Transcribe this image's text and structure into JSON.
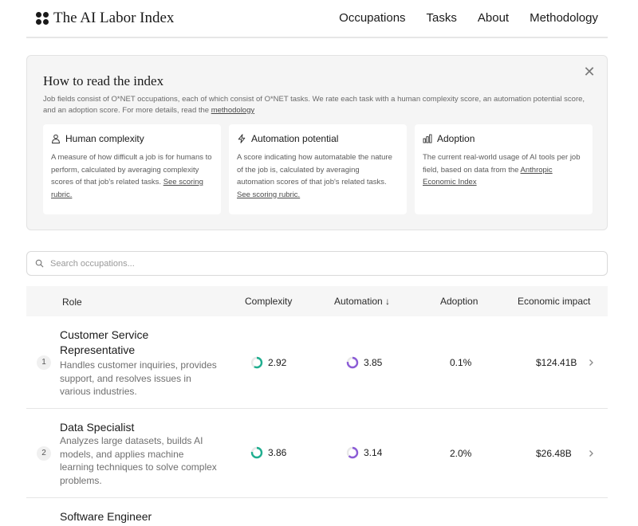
{
  "header": {
    "brand": "The AI Labor Index",
    "nav": [
      "Occupations",
      "Tasks",
      "About",
      "Methodology"
    ]
  },
  "info": {
    "title": "How to read the index",
    "desc_text": "Job fields consist of O*NET occupations, each of which consist of O*NET tasks. We rate each task with a human complexity score, an automation potential score, and an adoption score. For more details, read the ",
    "desc_link": "methodology",
    "cards": [
      {
        "icon": "person-icon",
        "title": "Human complexity",
        "text": "A measure of how difficult a job is for humans to perform, calculated by averaging complexity scores of that job's related tasks. ",
        "link": "See scoring rubric."
      },
      {
        "icon": "lightning-icon",
        "title": "Automation potential",
        "text": "A score indicating how automatable the nature of the job is, calculated by averaging automation scores of that job's related tasks. ",
        "link": "See scoring rubric."
      },
      {
        "icon": "bar-chart-icon",
        "title": "Adoption",
        "text": "The current real-world usage of AI tools per job field, based on data from the ",
        "link": "Anthropic Economic Index"
      }
    ]
  },
  "search": {
    "placeholder": "Search occupations..."
  },
  "table": {
    "headers": {
      "role": "Role",
      "complexity": "Complexity",
      "automation": "Automation ↓",
      "adoption": "Adoption",
      "economic": "Economic impact"
    },
    "rows": [
      {
        "rank": "1",
        "title": "Customer Service Representative",
        "desc": "Handles customer inquiries, provides support, and resolves issues in various industries.",
        "complexity": 2.92,
        "complexity_label": "2.92",
        "automation": 3.85,
        "automation_label": "3.85",
        "adoption": "0.1%",
        "economic": "$124.41B"
      },
      {
        "rank": "2",
        "title": "Data Specialist",
        "desc": "Analyzes large datasets, builds AI models, and applies machine learning techniques to solve complex problems.",
        "complexity": 3.86,
        "complexity_label": "3.86",
        "automation": 3.14,
        "automation_label": "3.14",
        "adoption": "2.0%",
        "economic": "$26.48B"
      },
      {
        "title": "Software Engineer"
      }
    ]
  },
  "colors": {
    "complexity_ring": "#1fae8f",
    "automation_ring": "#8b5cd6",
    "ring_track": "#e8e8e8"
  }
}
